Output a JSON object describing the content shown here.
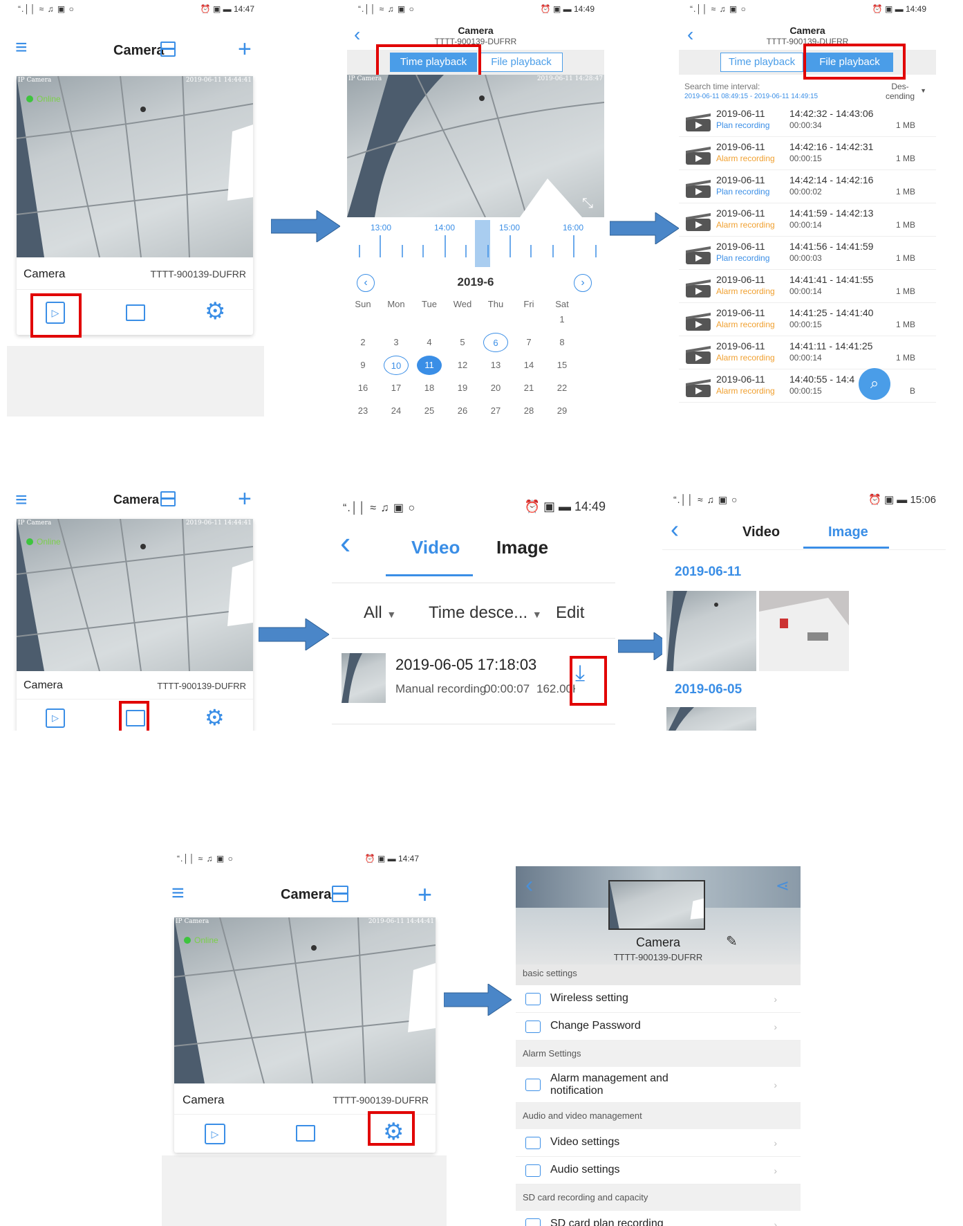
{
  "status": {
    "icons_left": "“.││ ≈ ♫ ▣ ○",
    "p1_time": "14:47",
    "p2_time": "14:49",
    "p3_time": "14:49",
    "p5_time": "14:49",
    "p6_time": "15:06",
    "p7_time": "14:47"
  },
  "home": {
    "title": "Camera",
    "camera_name": "Camera",
    "device_id": "TTTT-900139-DUFRR",
    "online": "Online",
    "cam_label": "IP Camera",
    "cam_timestamp": "2019-06-11 14:44:41"
  },
  "playback": {
    "title": "Camera",
    "subtitle": "TTTT-900139-DUFRR",
    "tab_time": "Time playback",
    "tab_file": "File playback",
    "timeline": [
      "13:00",
      "14:00",
      "15:00",
      "16:00"
    ],
    "cam_timestamp": "2019-06-11 14:28:47",
    "month": "2019-6",
    "weekdays": [
      "Sun",
      "Mon",
      "Tue",
      "Wed",
      "Thu",
      "Fri",
      "Sat"
    ],
    "days": [
      "1",
      "2",
      "3",
      "4",
      "5",
      "6",
      "7",
      "8",
      "9",
      "10",
      "11",
      "12",
      "13",
      "14",
      "15",
      "16",
      "17",
      "18",
      "19",
      "20",
      "21",
      "22",
      "23",
      "24",
      "25",
      "26",
      "27",
      "28",
      "29"
    ]
  },
  "files": {
    "title": "Camera",
    "subtitle": "TTTT-900139-DUFRR",
    "interval_label": "Search time interval:",
    "interval": "2019-06-11 08:49:15 - 2019-06-11 14:49:15",
    "sort": "Des-\ncending",
    "records": [
      {
        "date": "2019-06-11",
        "type": "Plan recording",
        "time": "14:42:32 - 14:43:06",
        "dur": "00:00:34",
        "size": "1 MB",
        "alarm": false
      },
      {
        "date": "2019-06-11",
        "type": "Alarm recording",
        "time": "14:42:16 - 14:42:31",
        "dur": "00:00:15",
        "size": "1 MB",
        "alarm": true
      },
      {
        "date": "2019-06-11",
        "type": "Plan recording",
        "time": "14:42:14 - 14:42:16",
        "dur": "00:00:02",
        "size": "1 MB",
        "alarm": false
      },
      {
        "date": "2019-06-11",
        "type": "Alarm recording",
        "time": "14:41:59 - 14:42:13",
        "dur": "00:00:14",
        "size": "1 MB",
        "alarm": true
      },
      {
        "date": "2019-06-11",
        "type": "Plan recording",
        "time": "14:41:56 - 14:41:59",
        "dur": "00:00:03",
        "size": "1 MB",
        "alarm": false
      },
      {
        "date": "2019-06-11",
        "type": "Alarm recording",
        "time": "14:41:41 - 14:41:55",
        "dur": "00:00:14",
        "size": "1 MB",
        "alarm": true
      },
      {
        "date": "2019-06-11",
        "type": "Alarm recording",
        "time": "14:41:25 - 14:41:40",
        "dur": "00:00:15",
        "size": "1 MB",
        "alarm": true
      },
      {
        "date": "2019-06-11",
        "type": "Alarm recording",
        "time": "14:41:11 - 14:41:25",
        "dur": "00:00:14",
        "size": "1 MB",
        "alarm": true
      },
      {
        "date": "2019-06-11",
        "type": "Alarm recording",
        "time": "14:40:55 - 14:4",
        "dur": "00:00:15",
        "size": "B",
        "alarm": true
      }
    ]
  },
  "video": {
    "tab_video": "Video",
    "tab_image": "Image",
    "filter_all": "All",
    "filter_sort": "Time desce...",
    "edit": "Edit",
    "item_date": "2019-06-05 17:18:03",
    "item_type": "Manual recording",
    "item_dur": "00:00:07",
    "item_size": "162.00KB"
  },
  "images": {
    "tab_video": "Video",
    "tab_image": "Image",
    "date1": "2019-06-11",
    "date2": "2019-06-05"
  },
  "settings": {
    "camera_name": "Camera",
    "device_id": "TTTT-900139-DUFRR",
    "sec_basic": "basic settings",
    "wireless": "Wireless setting",
    "password": "Change Password",
    "sec_alarm": "Alarm Settings",
    "alarm": "Alarm management and notification",
    "sec_av": "Audio and video management",
    "video": "Video settings",
    "audio": "Audio settings",
    "sec_sd": "SD card recording and capacity",
    "sd": "SD card plan recording"
  },
  "colors": {
    "accent": "#3a8ee6",
    "highlight": "#e10000",
    "alarm": "#f0a030",
    "arrow": "#4a86c8"
  }
}
